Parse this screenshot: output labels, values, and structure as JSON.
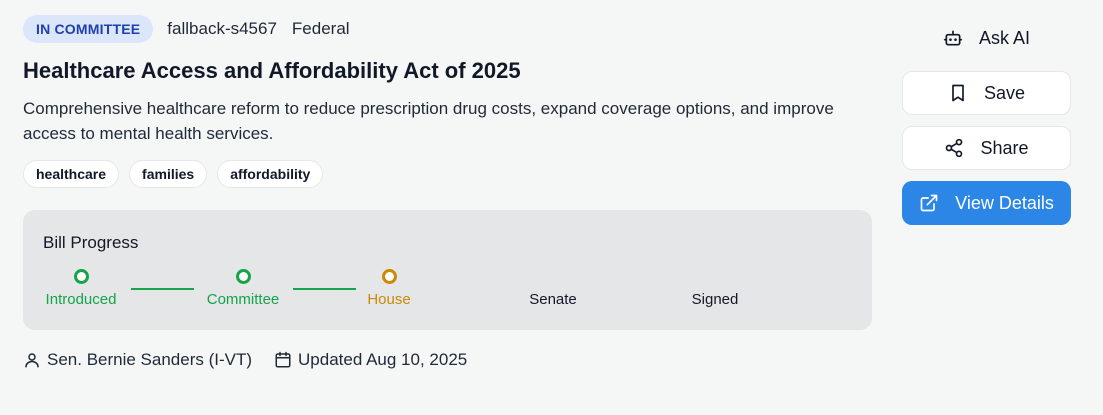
{
  "bill": {
    "status": "IN COMMITTEE",
    "id": "fallback-s4567",
    "jurisdiction": "Federal",
    "title": "Healthcare Access and Affordability Act of 2025",
    "description": "Comprehensive healthcare reform to reduce prescription drug costs, expand coverage options, and improve access to mental health services.",
    "tags": [
      "healthcare",
      "families",
      "affordability"
    ]
  },
  "progress": {
    "title": "Bill Progress",
    "stages": [
      {
        "label": "Introduced",
        "state": "done"
      },
      {
        "label": "Committee",
        "state": "done"
      },
      {
        "label": "House",
        "state": "current"
      },
      {
        "label": "Senate",
        "state": "pending"
      },
      {
        "label": "Signed",
        "state": "pending"
      }
    ]
  },
  "footer": {
    "sponsor": "Sen. Bernie Sanders (I-VT)",
    "updated": "Updated Aug 10, 2025"
  },
  "actions": {
    "ask_ai": "Ask AI",
    "save": "Save",
    "share": "Share",
    "view_details": "View Details"
  },
  "colors": {
    "status_badge_bg": "#dbe6fb",
    "status_badge_text": "#1e40af",
    "stage_done": "#16a34a",
    "stage_current": "#ca8a04",
    "primary_button": "#2b86e6"
  },
  "icons": {
    "ask_ai": "robot-icon",
    "save": "bookmark-icon",
    "share": "share-icon",
    "view_details": "external-link-icon",
    "sponsor": "user-icon",
    "updated": "calendar-icon"
  }
}
